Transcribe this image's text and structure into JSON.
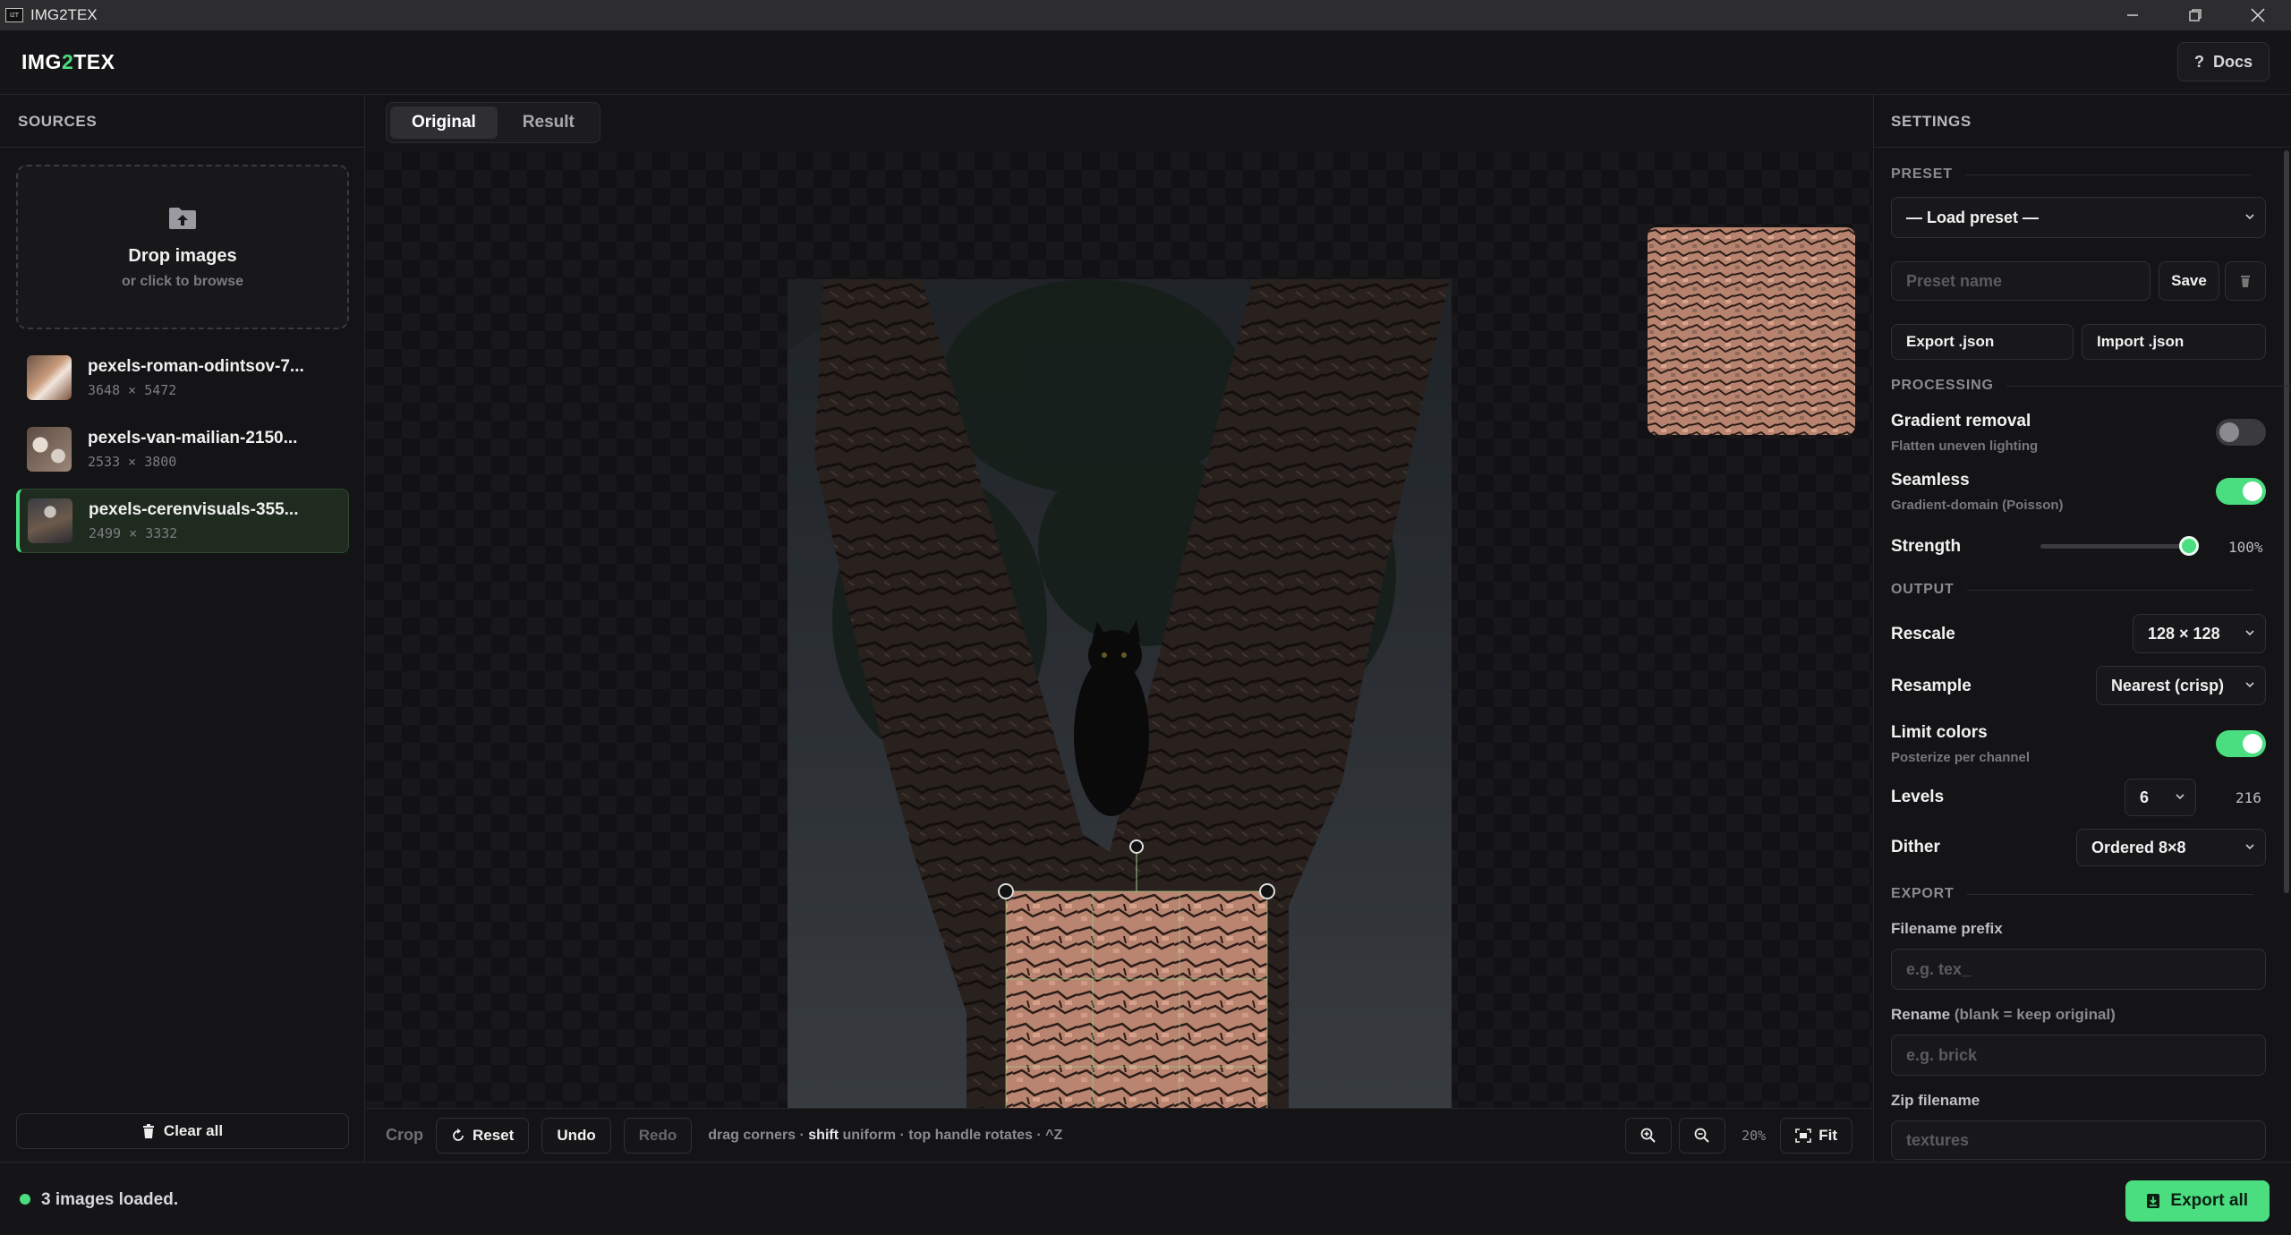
{
  "window": {
    "title": "IMG2TEX",
    "icon_text": "I2T",
    "controls": [
      "minimize",
      "restore",
      "close"
    ]
  },
  "header": {
    "logo_prefix": "IMG",
    "logo_accent": "2",
    "logo_suffix": "TEX",
    "docs_label": "Docs"
  },
  "sources": {
    "title": "SOURCES",
    "drop_title": "Drop images",
    "drop_sub": "or click to browse",
    "files": [
      {
        "name": "pexels-roman-odintsov-7...",
        "dims": "3648 × 5472",
        "active": false
      },
      {
        "name": "pexels-van-mailian-2150...",
        "dims": "2533 × 3800",
        "active": false
      },
      {
        "name": "pexels-cerenvisuals-355...",
        "dims": "2499 × 3332",
        "active": true
      }
    ],
    "clear_label": "Clear all"
  },
  "viewer": {
    "tabs": [
      {
        "label": "Original",
        "active": true
      },
      {
        "label": "Result",
        "active": false
      }
    ],
    "toolbar": {
      "crop_label": "Crop",
      "reset_label": "Reset",
      "undo_label": "Undo",
      "redo_label": "Redo",
      "hint_pre": "drag corners · ",
      "hint_bold": "shift",
      "hint_post": " uniform · top handle rotates · ^Z",
      "zoom_percent": "20%",
      "fit_label": "Fit"
    }
  },
  "settings": {
    "title": "SETTINGS",
    "preset": {
      "heading": "PRESET",
      "load_label": "— Load preset —",
      "name_placeholder": "Preset name",
      "save_label": "Save",
      "export_label": "Export .json",
      "import_label": "Import .json"
    },
    "processing": {
      "heading": "PROCESSING",
      "gradient_label": "Gradient removal",
      "gradient_sub": "Flatten uneven lighting",
      "gradient_on": false,
      "seamless_label": "Seamless",
      "seamless_sub": "Gradient-domain (Poisson)",
      "seamless_on": true,
      "strength_label": "Strength",
      "strength_value": "100%",
      "strength_fraction": 1.0
    },
    "output": {
      "heading": "OUTPUT",
      "rescale_label": "Rescale",
      "rescale_value": "128 × 128",
      "resample_label": "Resample",
      "resample_value": "Nearest (crisp)",
      "limit_label": "Limit colors",
      "limit_sub": "Posterize per channel",
      "limit_on": true,
      "levels_label": "Levels",
      "levels_value": "6",
      "levels_count": "216",
      "dither_label": "Dither",
      "dither_value": "Ordered 8×8"
    },
    "export": {
      "heading": "EXPORT",
      "prefix_label": "Filename prefix",
      "prefix_placeholder": "e.g. tex_",
      "rename_label": "Rename",
      "rename_hint": "(blank = keep original)",
      "rename_placeholder": "e.g. brick",
      "zip_label": "Zip filename",
      "zip_placeholder": "textures"
    }
  },
  "status": {
    "text": "3 images loaded.",
    "export_all_label": "Export all"
  },
  "colors": {
    "accent": "#4ade80",
    "background": "#141416",
    "panel_border": "#26262a"
  }
}
